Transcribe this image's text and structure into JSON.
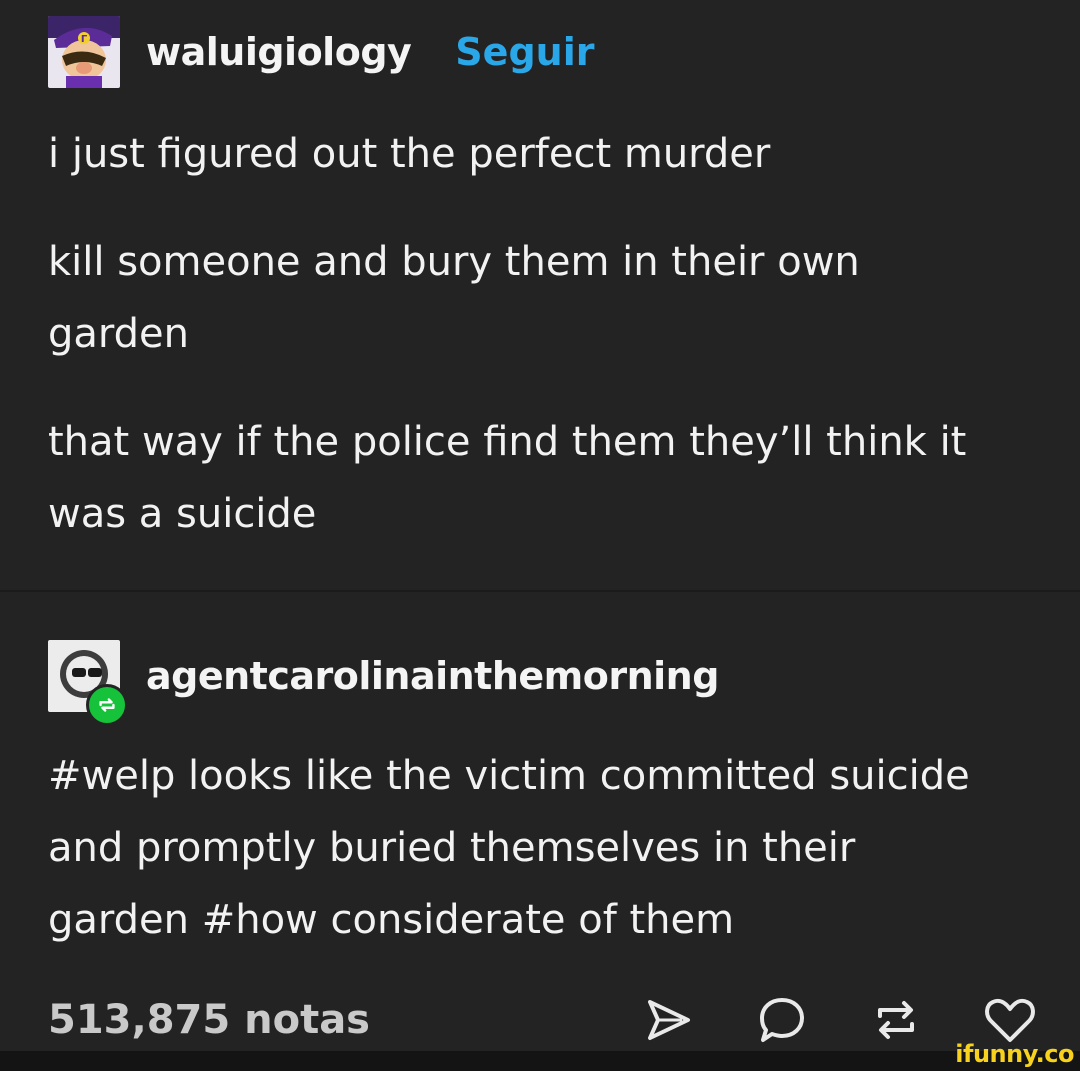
{
  "post": {
    "username": "waluigiology",
    "follow_label": "Seguir",
    "paragraphs": [
      "i just figured out the perfect murder",
      "kill someone and bury them in their own garden",
      "that way if the police find them they’ll think it was a suicide"
    ]
  },
  "reblog": {
    "username": "agentcarolinainthemorning",
    "tags_text": "#welp looks like the victim committed suicide and promptly buried themselves in their garden #how considerate of them"
  },
  "footer": {
    "notes": "513,875 notas",
    "icons": [
      "share-icon",
      "comment-icon",
      "reblog-icon",
      "like-icon"
    ]
  },
  "watermark": "ifunny.co",
  "colors": {
    "background": "#232323",
    "text": "#f2f2f2",
    "follow": "#2aa7e8",
    "reblog_badge": "#15c23a",
    "watermark": "#f6d11d"
  }
}
